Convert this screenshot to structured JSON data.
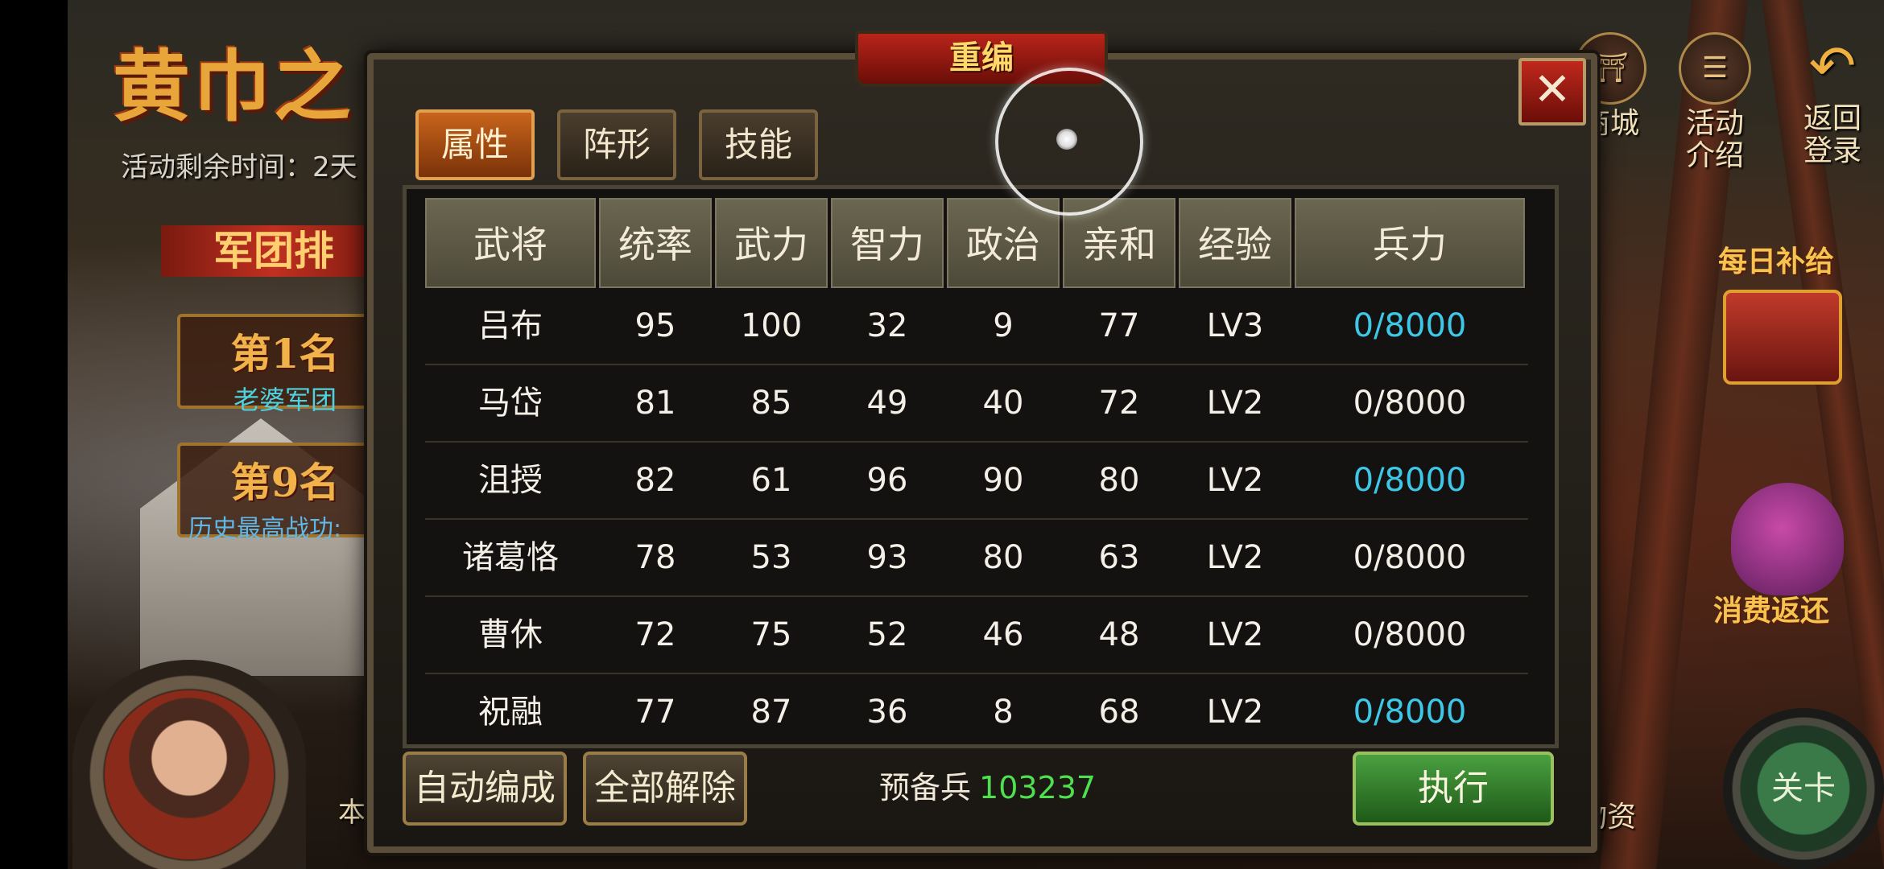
{
  "background": {
    "event_title": "黄巾之",
    "timer_text": "活动剩余时间：2天",
    "rank_banner": "军团排",
    "rank_cards": [
      {
        "rank": "第1名",
        "sub": "老婆军团"
      },
      {
        "rank": "第9名",
        "sub": "历史最高战功:"
      }
    ],
    "right_icons": [
      {
        "icon": "shop-icon",
        "label": "商城"
      },
      {
        "icon": "activity-icon",
        "label": "活动介绍"
      },
      {
        "icon": "return-icon",
        "label": "返回登录"
      }
    ],
    "daily_supply": "每日补给",
    "consume_rebate": "消费返还",
    "stage_label": "关卡",
    "bottom_partial": "本",
    "bottom_right_partial": "物资"
  },
  "dialog": {
    "title": "重编",
    "close_label": "✕",
    "tabs": [
      {
        "label": "属性",
        "active": true
      },
      {
        "label": "阵形",
        "active": false
      },
      {
        "label": "技能",
        "active": false
      }
    ],
    "table": {
      "headers": [
        "武将",
        "统率",
        "武力",
        "智力",
        "政治",
        "亲和",
        "经验",
        "兵力"
      ],
      "rows": [
        {
          "name": "吕布",
          "lead": "95",
          "war": "100",
          "int": "32",
          "pol": "9",
          "cha": "77",
          "exp": "LV3",
          "troops": "0/8000",
          "highlight": true
        },
        {
          "name": "马岱",
          "lead": "81",
          "war": "85",
          "int": "49",
          "pol": "40",
          "cha": "72",
          "exp": "LV2",
          "troops": "0/8000",
          "highlight": false
        },
        {
          "name": "沮授",
          "lead": "82",
          "war": "61",
          "int": "96",
          "pol": "90",
          "cha": "80",
          "exp": "LV2",
          "troops": "0/8000",
          "highlight": true
        },
        {
          "name": "诸葛恪",
          "lead": "78",
          "war": "53",
          "int": "93",
          "pol": "80",
          "cha": "63",
          "exp": "LV2",
          "troops": "0/8000",
          "highlight": false
        },
        {
          "name": "曹休",
          "lead": "72",
          "war": "75",
          "int": "52",
          "pol": "46",
          "cha": "48",
          "exp": "LV2",
          "troops": "0/8000",
          "highlight": false
        },
        {
          "name": "祝融",
          "lead": "77",
          "war": "87",
          "int": "36",
          "pol": "8",
          "cha": "68",
          "exp": "LV2",
          "troops": "0/8000",
          "highlight": true
        }
      ]
    },
    "buttons": {
      "auto": "自动编成",
      "release_all": "全部解除",
      "execute": "执行"
    },
    "reserve_label": "预备兵",
    "reserve_value": "103237"
  },
  "colors": {
    "highlight_troops": "#3ec8e8",
    "reserve_value": "#4ee04e"
  }
}
